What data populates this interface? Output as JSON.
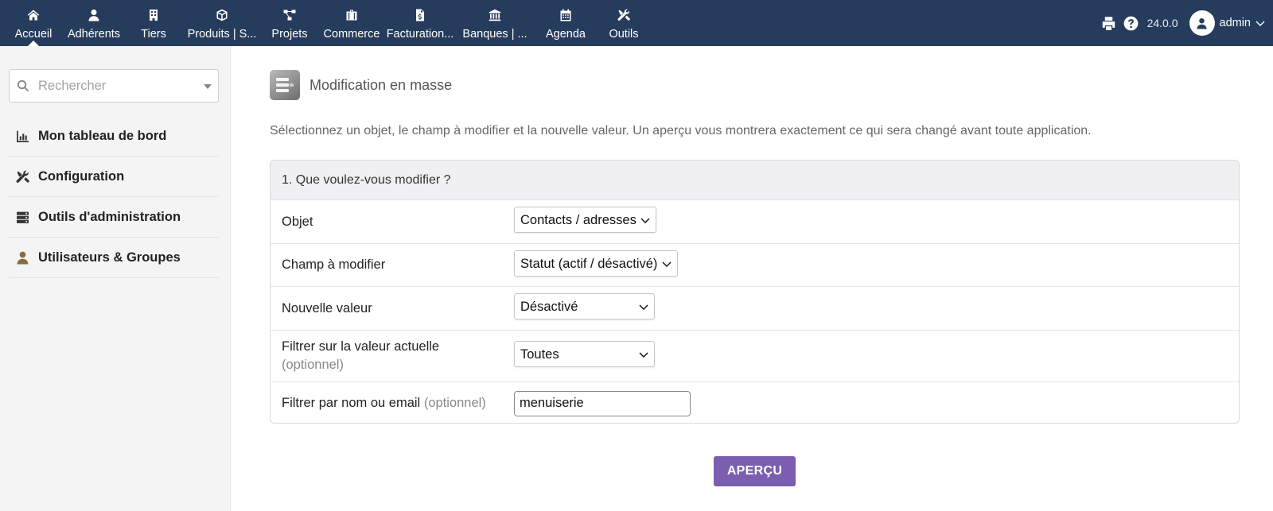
{
  "topbar": {
    "nav": [
      {
        "label": "Accueil",
        "icon": "home-icon"
      },
      {
        "label": "Adhérents",
        "icon": "user-icon"
      },
      {
        "label": "Tiers",
        "icon": "building-icon"
      },
      {
        "label": "Produits | S...",
        "icon": "cube-icon"
      },
      {
        "label": "Projets",
        "icon": "project-diagram-icon"
      },
      {
        "label": "Commerce",
        "icon": "briefcase-icon"
      },
      {
        "label": "Facturation...",
        "icon": "invoice-icon"
      },
      {
        "label": "Banques | ...",
        "icon": "bank-icon"
      },
      {
        "label": "Agenda",
        "icon": "calendar-icon"
      },
      {
        "label": "Outils",
        "icon": "tools-icon"
      }
    ],
    "active_index": 0,
    "version": "24.0.0",
    "username": "admin"
  },
  "sidebar": {
    "search_placeholder": "Rechercher",
    "items": [
      {
        "label": "Mon tableau de bord",
        "icon": "chart-bar-icon"
      },
      {
        "label": "Configuration",
        "icon": "tools-icon"
      },
      {
        "label": "Outils d'administration",
        "icon": "server-icon"
      },
      {
        "label": "Utilisateurs & Groupes",
        "icon": "user-icon"
      }
    ]
  },
  "main": {
    "title": "Modification en masse",
    "intro": "Sélectionnez un objet, le champ à modifier et la nouvelle valeur. Un aperçu vous montrera exactement ce qui sera changé avant toute application.",
    "panel_title": "1. Que voulez-vous modifier ?",
    "rows": {
      "object": {
        "label": "Objet",
        "value": "Contacts / adresses"
      },
      "field": {
        "label": "Champ à modifier",
        "value": "Statut (actif / désactivé)"
      },
      "new_value": {
        "label": "Nouvelle valeur",
        "value": "Désactivé"
      },
      "filter_current": {
        "label": "Filtrer sur la valeur actuelle",
        "optional": "(optionnel)",
        "value": "Toutes"
      },
      "filter_name": {
        "label": "Filtrer par nom ou email",
        "optional": "(optionnel)",
        "value": "menuiserie"
      }
    },
    "preview_button": "APERÇU"
  },
  "colors": {
    "topbar": "#263c5c",
    "button": "#7c5eb0",
    "sidebar_bg": "#f4f4f4",
    "user_icon_sidebar": "#8b6a3e"
  }
}
